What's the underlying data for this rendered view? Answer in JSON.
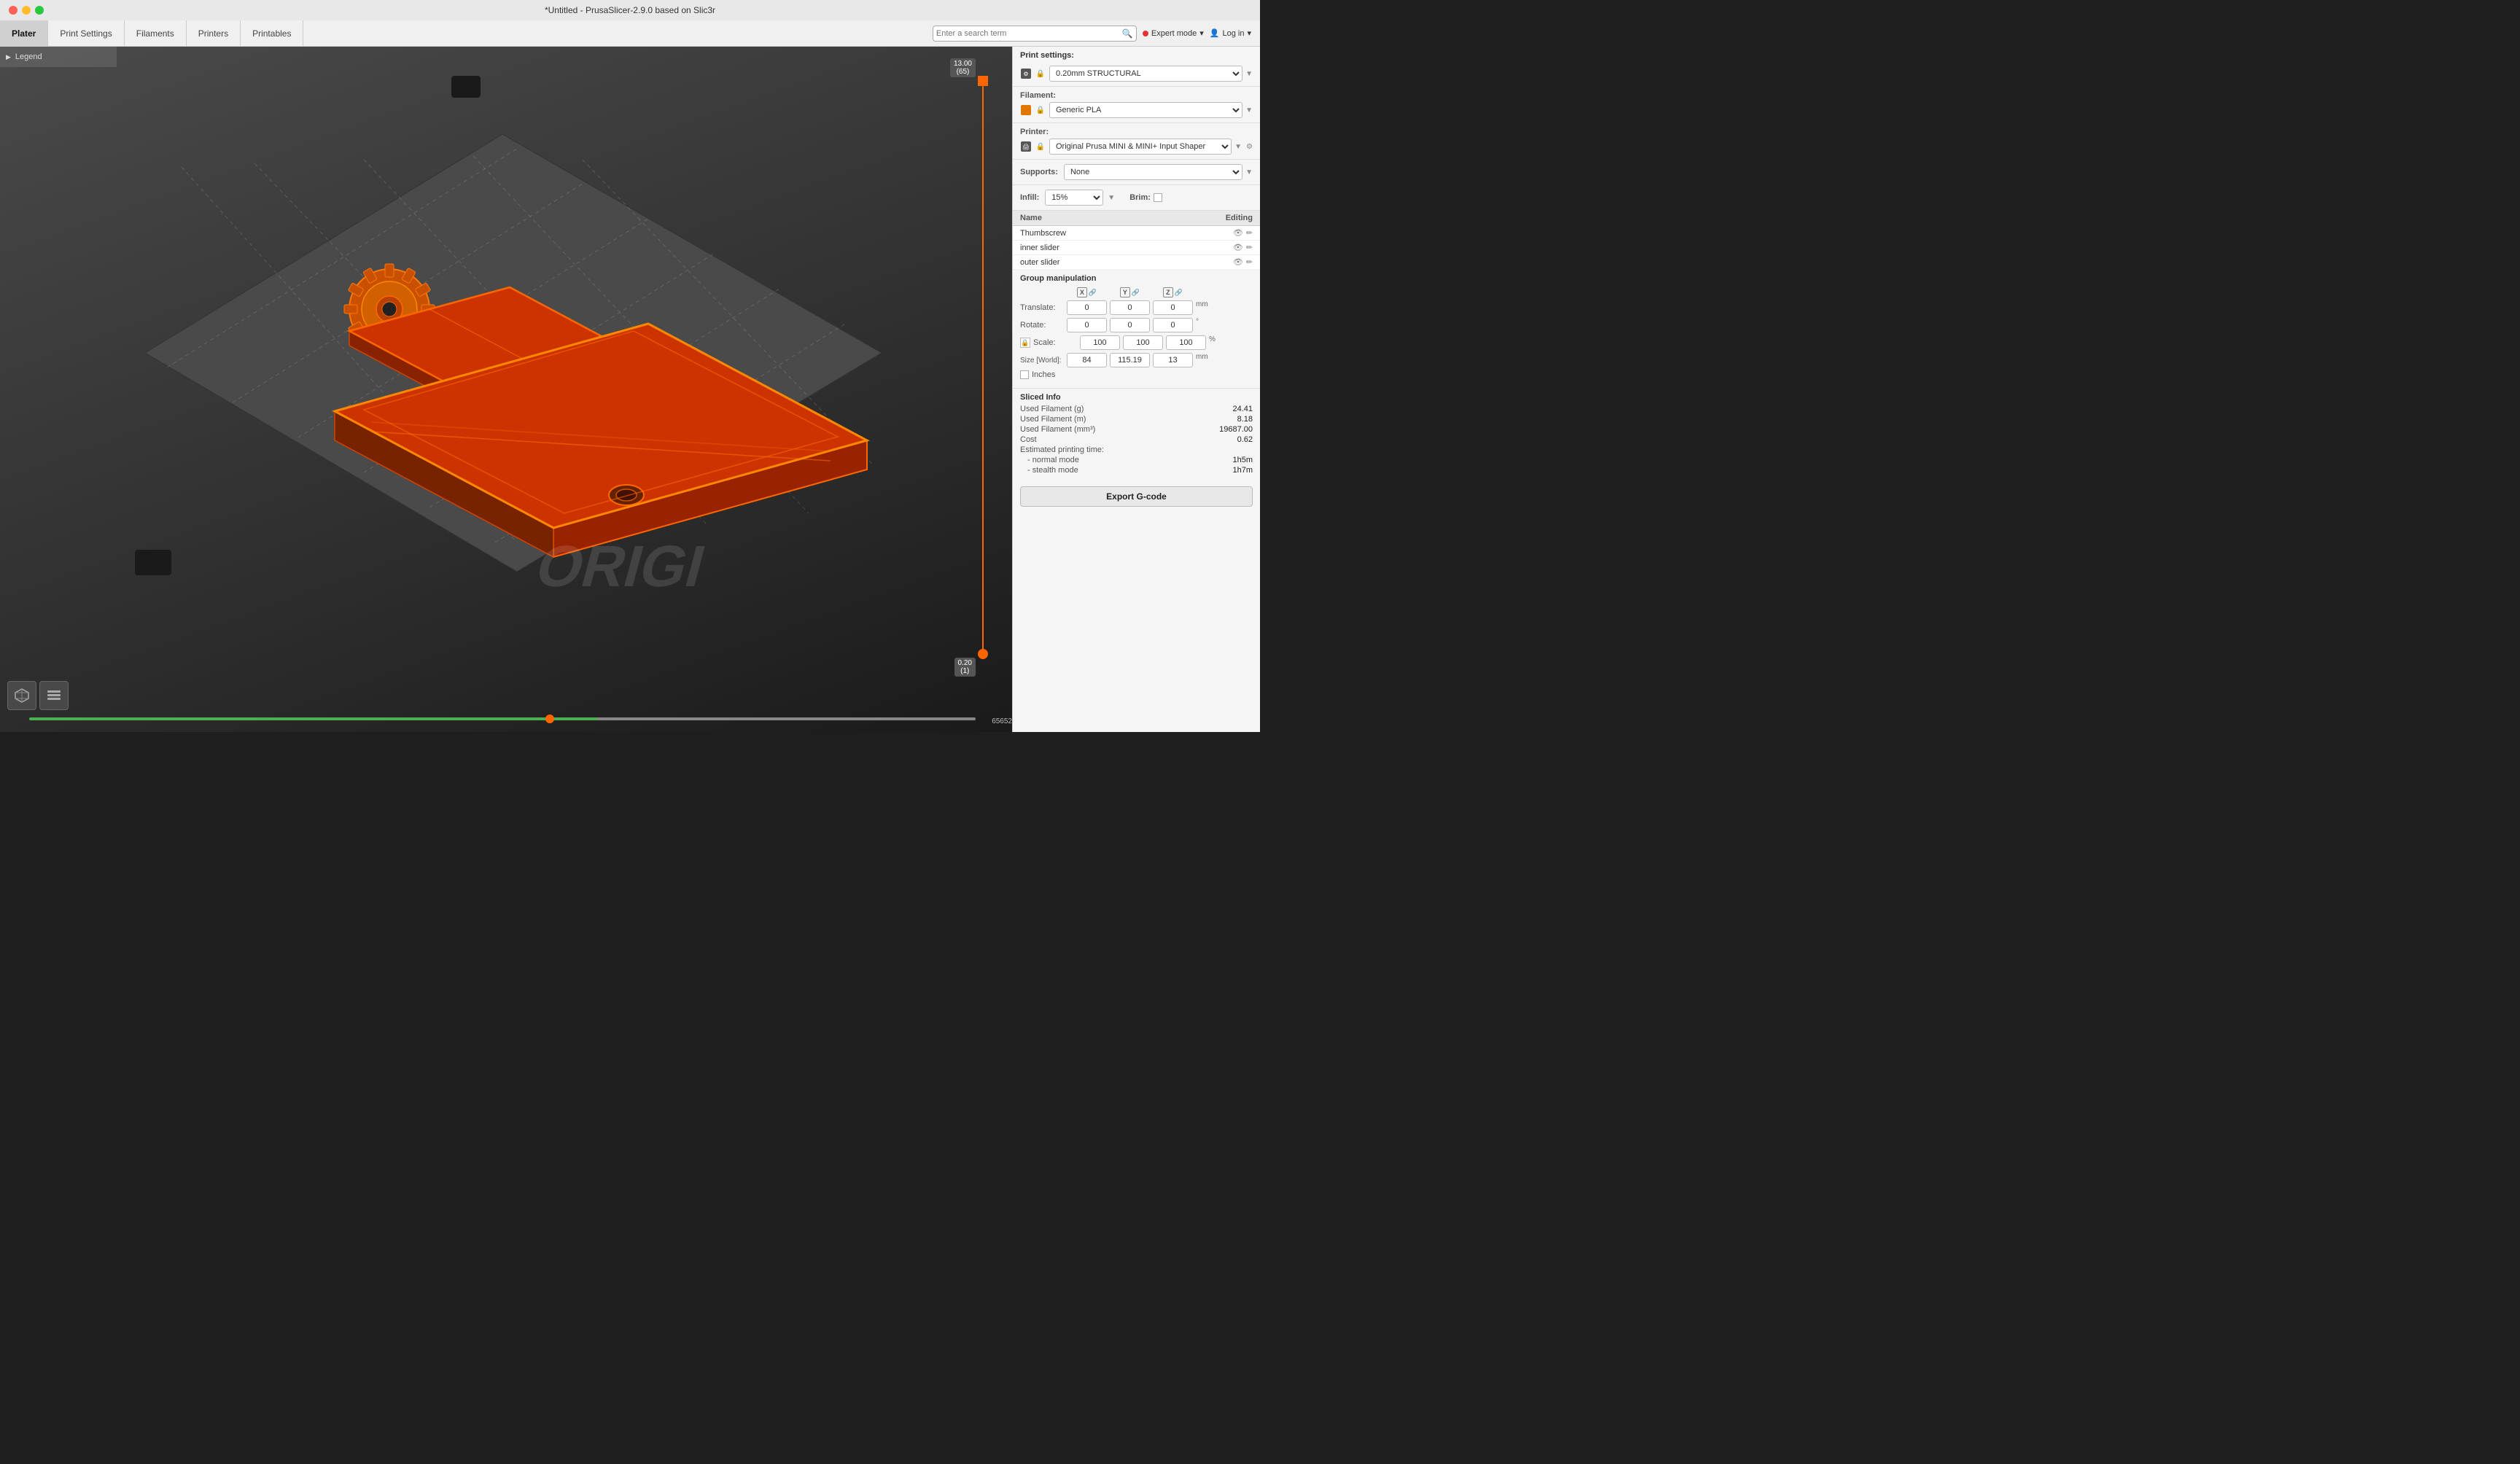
{
  "titlebar": {
    "title": "*Untitled - PrusaSlicer-2.9.0 based on Slic3r"
  },
  "navbar": {
    "tabs": [
      {
        "id": "plater",
        "label": "Plater",
        "active": true
      },
      {
        "id": "print-settings",
        "label": "Print Settings",
        "active": false
      },
      {
        "id": "filaments",
        "label": "Filaments",
        "active": false
      },
      {
        "id": "printers",
        "label": "Printers",
        "active": false
      },
      {
        "id": "printables",
        "label": "Printables",
        "active": false
      }
    ],
    "search": {
      "placeholder": "Enter a search term"
    },
    "expert_mode": "Expert mode",
    "login": "Log in"
  },
  "legend": {
    "label": "Legend"
  },
  "viewport": {
    "z_top": "13.00\n(65)",
    "z_top_val": "13.00",
    "z_top_sub": "(65)",
    "z_bot_val": "0.20",
    "z_bot_sub": "(1)",
    "bottom_slider_value": "65652"
  },
  "right_panel": {
    "print_settings_label": "Print settings:",
    "print_setting": "0.20mm STRUCTURAL",
    "filament_label": "Filament:",
    "filament": "Generic PLA",
    "printer_label": "Printer:",
    "printer": "Original Prusa MINI & MINI+ Input Shaper",
    "supports_label": "Supports:",
    "supports": "None",
    "infill_label": "Infill:",
    "infill_value": "15%",
    "brim_label": "Brim:",
    "objects": {
      "col_name": "Name",
      "col_editing": "Editing",
      "items": [
        {
          "name": "Thumbscrew"
        },
        {
          "name": "inner slider"
        },
        {
          "name": "outer slider"
        }
      ]
    },
    "group_manip": {
      "title": "Group manipulation",
      "axes": [
        "X",
        "Y",
        "Z"
      ],
      "translate_label": "Translate:",
      "translate_values": [
        "0",
        "0",
        "0"
      ],
      "translate_unit": "mm",
      "rotate_label": "Rotate:",
      "rotate_values": [
        "0",
        "0",
        "0"
      ],
      "rotate_unit": "°",
      "scale_label": "Scale:",
      "scale_values": [
        "100",
        "100",
        "100"
      ],
      "scale_unit": "%",
      "size_label": "Size [World]:",
      "size_values": [
        "84",
        "115.19",
        "13"
      ],
      "size_unit": "mm",
      "inches_label": "Inches"
    },
    "sliced_info": {
      "title": "Sliced Info",
      "rows": [
        {
          "key": "Used Filament (g)",
          "val": "24.41"
        },
        {
          "key": "Used Filament (m)",
          "val": "8.18"
        },
        {
          "key": "Used Filament (mm³)",
          "val": "19687.00"
        },
        {
          "key": "Cost",
          "val": "0.62"
        }
      ],
      "print_time_label": "Estimated printing time:",
      "normal_mode_label": "- normal mode",
      "normal_mode_val": "1h5m",
      "stealth_mode_label": "- stealth mode",
      "stealth_mode_val": "1h7m"
    },
    "export_label": "Export G-code"
  }
}
